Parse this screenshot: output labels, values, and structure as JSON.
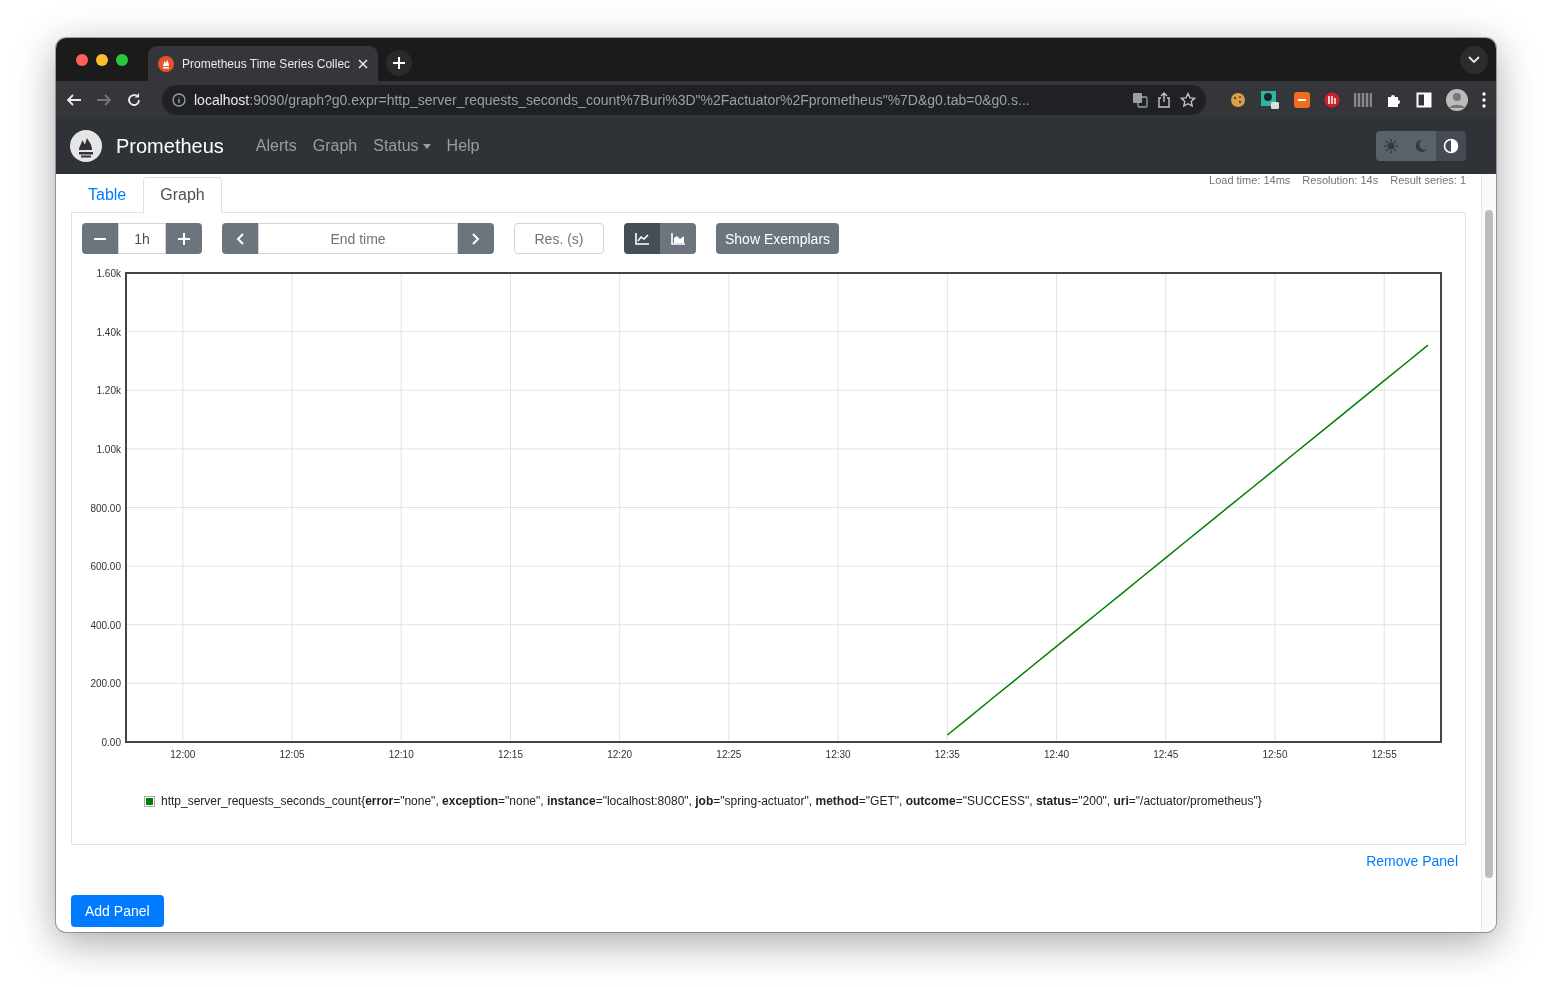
{
  "browser": {
    "tab": {
      "title": "Prometheus Time Series Collec"
    },
    "url": {
      "host": "localhost",
      "rest": ":9090/graph?g0.expr=http_server_requests_seconds_count%7Buri%3D\"%2Factuator%2Fprometheus\"%7D&g0.tab=0&g0.s..."
    }
  },
  "navbar": {
    "brand": "Prometheus",
    "links": [
      {
        "label": "Alerts",
        "dropdown": false
      },
      {
        "label": "Graph",
        "dropdown": false
      },
      {
        "label": "Status",
        "dropdown": true
      },
      {
        "label": "Help",
        "dropdown": false
      }
    ],
    "themes": [
      {
        "kind": "light",
        "selected": false
      },
      {
        "kind": "dark",
        "selected": false
      },
      {
        "kind": "auto",
        "selected": true
      }
    ]
  },
  "panel": {
    "tabs": [
      {
        "label": "Table",
        "selected": false
      },
      {
        "label": "Graph",
        "selected": true
      }
    ],
    "stats": [
      "Load time: 14ms",
      "Resolution: 14s",
      "Result series: 1"
    ],
    "range": {
      "value": "1h"
    },
    "end_time": {
      "placeholder": "End time"
    },
    "resolution": {
      "placeholder": "Res. (s)"
    },
    "chart_types": [
      {
        "kind": "line",
        "selected": true
      },
      {
        "kind": "stacked",
        "selected": false
      }
    ],
    "exemplars_button": "Show Exemplars",
    "chart_data": {
      "type": "line",
      "grid": true,
      "ylim": [
        0,
        1600
      ],
      "categories": [
        null,
        null,
        "12:00",
        null,
        null,
        null,
        null,
        "12:05",
        null,
        null,
        null,
        null,
        "12:10",
        null,
        null,
        null,
        null,
        "12:15",
        null,
        null,
        null,
        null,
        "12:20",
        null,
        null,
        null,
        null,
        "12:25",
        null,
        null,
        null,
        null,
        "12:30",
        null,
        null,
        null,
        null,
        "12:35",
        null,
        null,
        null,
        null,
        "12:40",
        null,
        null,
        null,
        null,
        "12:45",
        null,
        null,
        null,
        null,
        "12:50",
        null,
        null,
        null,
        null,
        "12:55",
        null,
        null
      ],
      "yticks": [
        {
          "value": 0,
          "label": "0.00"
        },
        {
          "value": 200,
          "label": "200.00"
        },
        {
          "value": 400,
          "label": "400.00"
        },
        {
          "value": 600,
          "label": "600.00"
        },
        {
          "value": 800,
          "label": "800.00"
        },
        {
          "value": 1000,
          "label": "1.00k"
        },
        {
          "value": 1200,
          "label": "1.20k"
        },
        {
          "value": 1400,
          "label": "1.40k"
        },
        {
          "value": 1600,
          "label": "1.60k"
        }
      ],
      "series": [
        {
          "name": "http_server_requests_seconds_count{**error**=\"none\", **exception**=\"none\", **instance**=\"localhost:8080\", **job**=\"spring-actuator\", **method**=\"GET\", **outcome**=\"SUCCESS\", **status**=\"200\", **uri**=\"/actuator/prometheus\"}",
          "color": "#008000",
          "values": [
            null,
            null,
            null,
            null,
            null,
            null,
            null,
            null,
            null,
            null,
            null,
            null,
            null,
            null,
            null,
            null,
            null,
            null,
            null,
            null,
            null,
            null,
            null,
            null,
            null,
            null,
            null,
            null,
            null,
            null,
            null,
            null,
            null,
            null,
            null,
            null,
            null,
            24,
            84,
            145,
            205,
            266,
            326,
            387,
            447,
            507,
            568,
            628,
            689,
            749,
            810,
            870,
            930,
            991,
            1051,
            1112,
            1172,
            1233,
            1293,
            1354
          ]
        }
      ]
    },
    "remove_link": "Remove Panel"
  },
  "add_button": "Add Panel"
}
